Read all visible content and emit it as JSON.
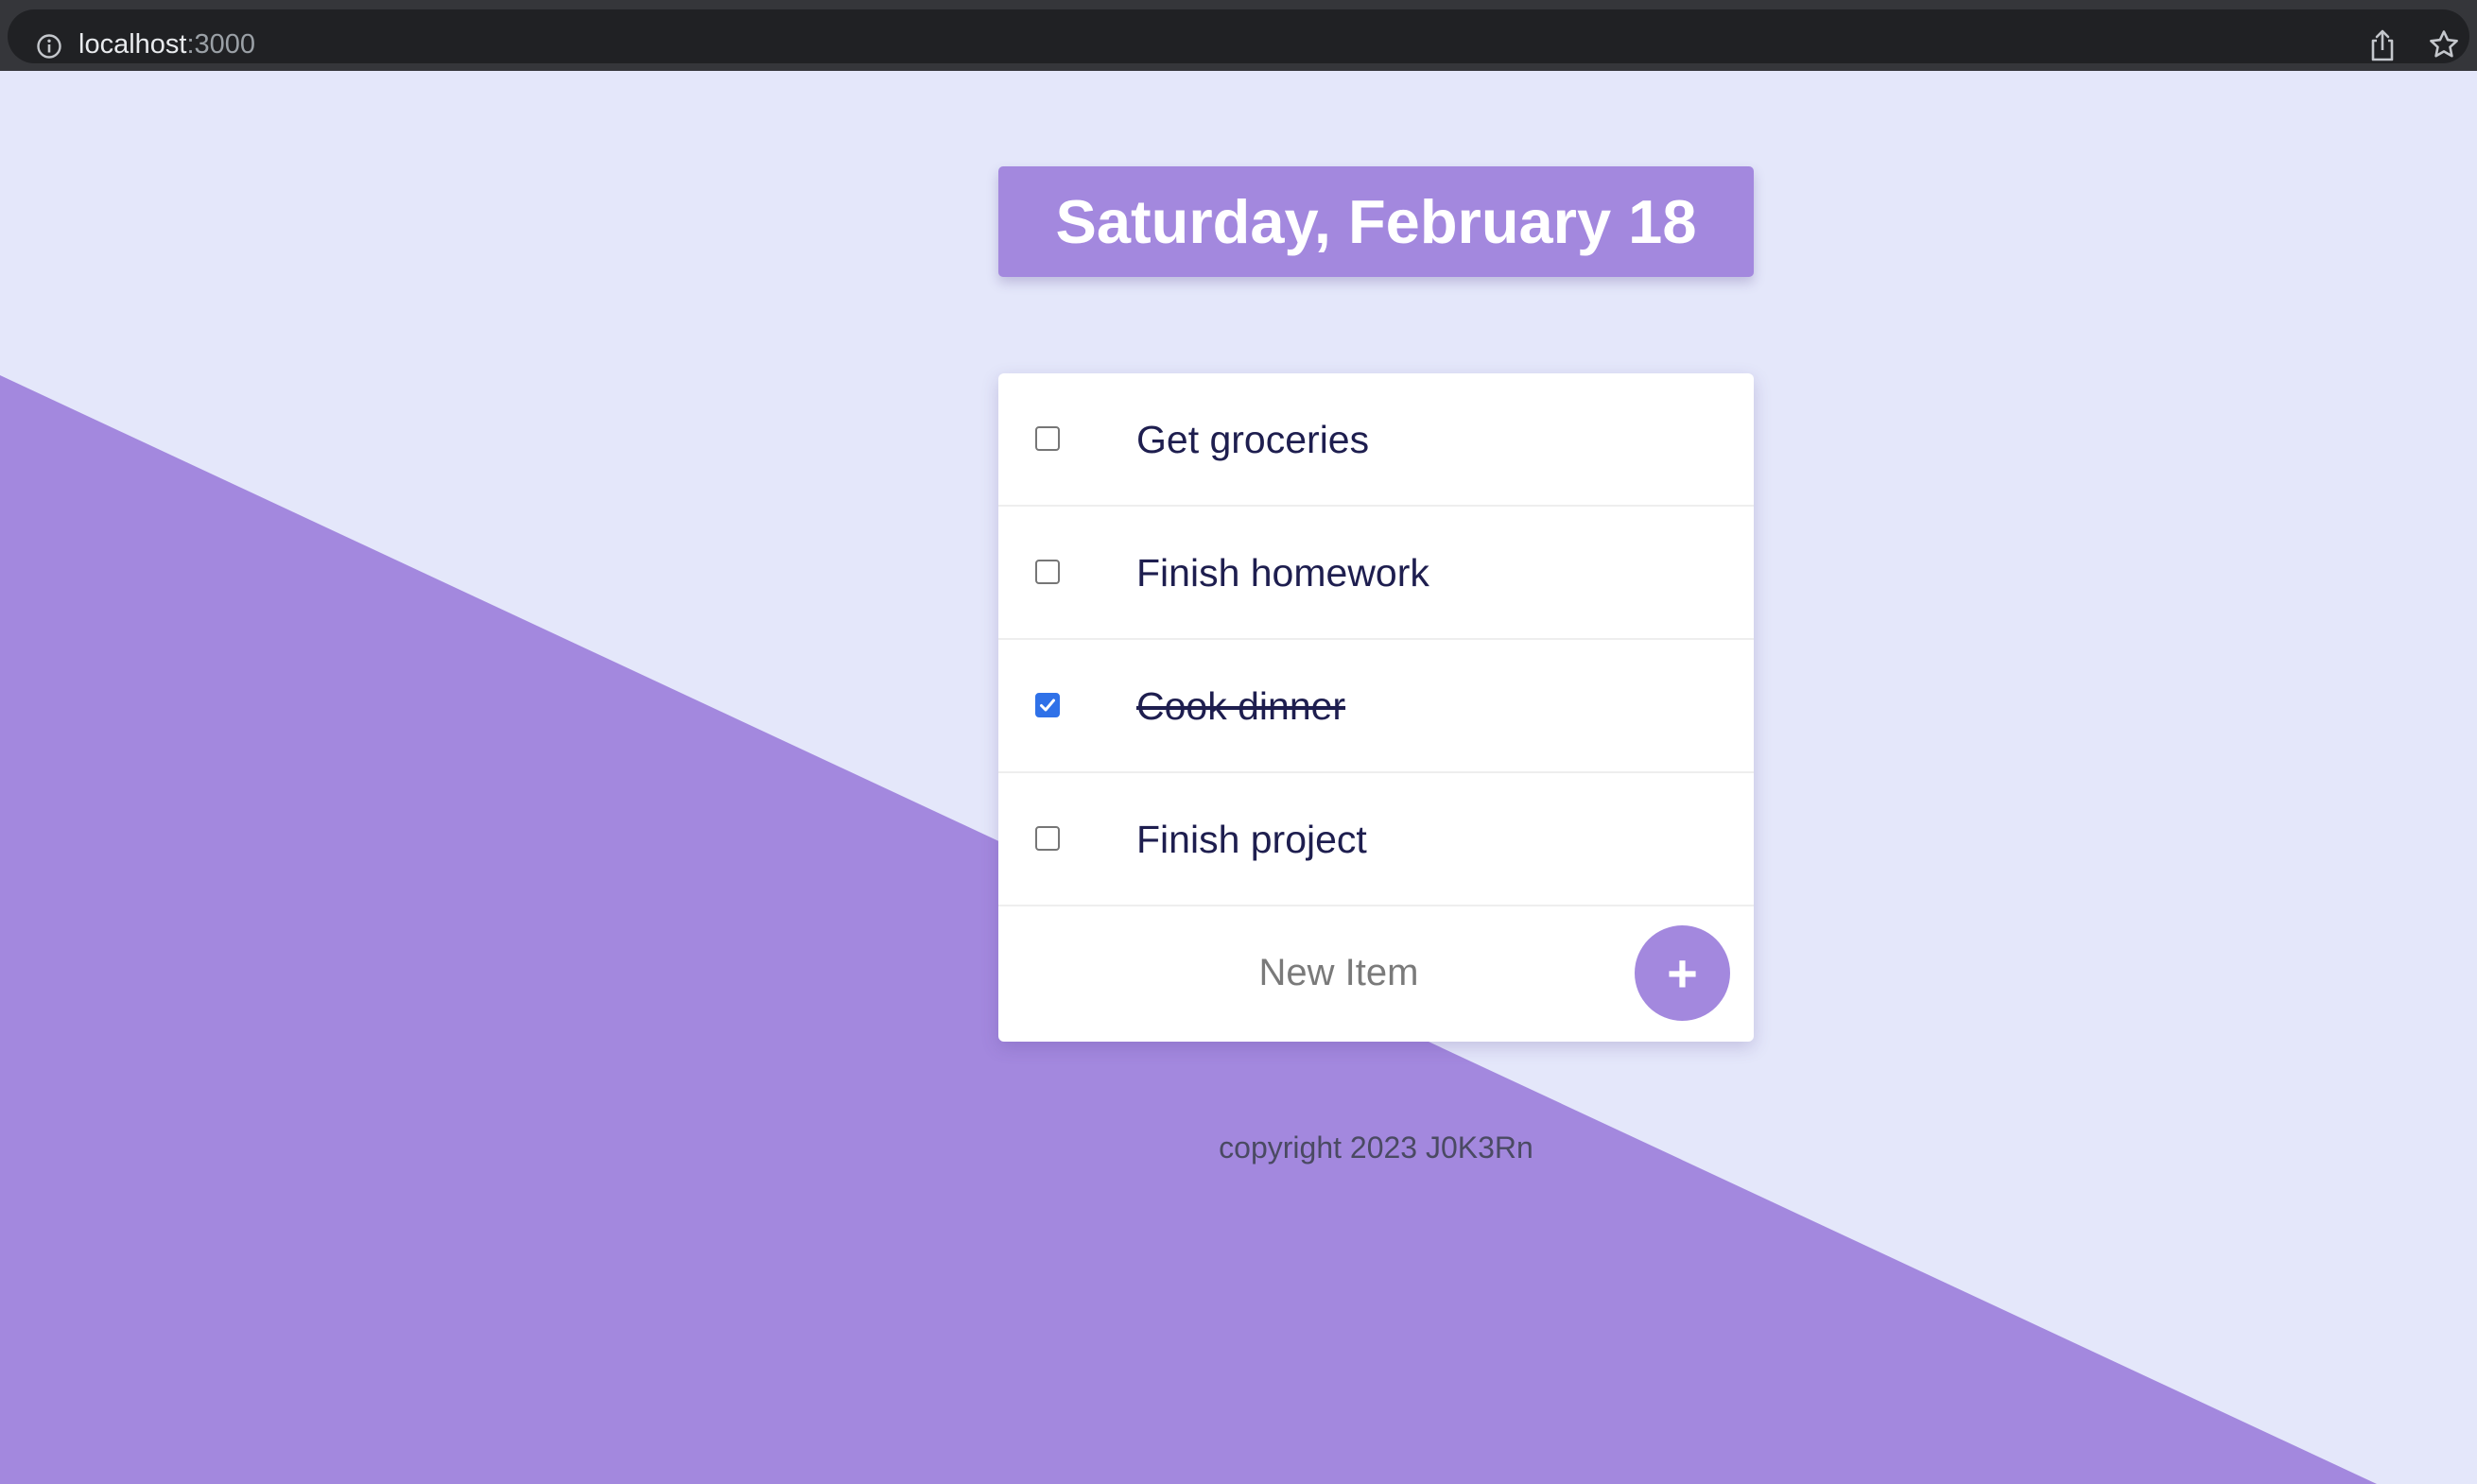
{
  "browser": {
    "url_host": "localhost",
    "url_port": ":3000"
  },
  "heading": {
    "date": "Saturday, February 18"
  },
  "todo": {
    "items": [
      {
        "label": "Get groceries",
        "checked": false
      },
      {
        "label": "Finish homework",
        "checked": false
      },
      {
        "label": "Cook dinner",
        "checked": true
      },
      {
        "label": "Finish project",
        "checked": false
      }
    ],
    "new_item_placeholder": "New Item",
    "add_button_label": "+"
  },
  "footer": {
    "text": "copyright 2023 J0K3Rn"
  },
  "colors": {
    "page_background": "#e4e7fa",
    "accent": "#a388de",
    "text": "#1e1e4f",
    "checkbox_checked": "#2f71e8"
  },
  "icons": {
    "info": "info-icon",
    "share": "share-icon",
    "bookmark": "star-icon"
  }
}
